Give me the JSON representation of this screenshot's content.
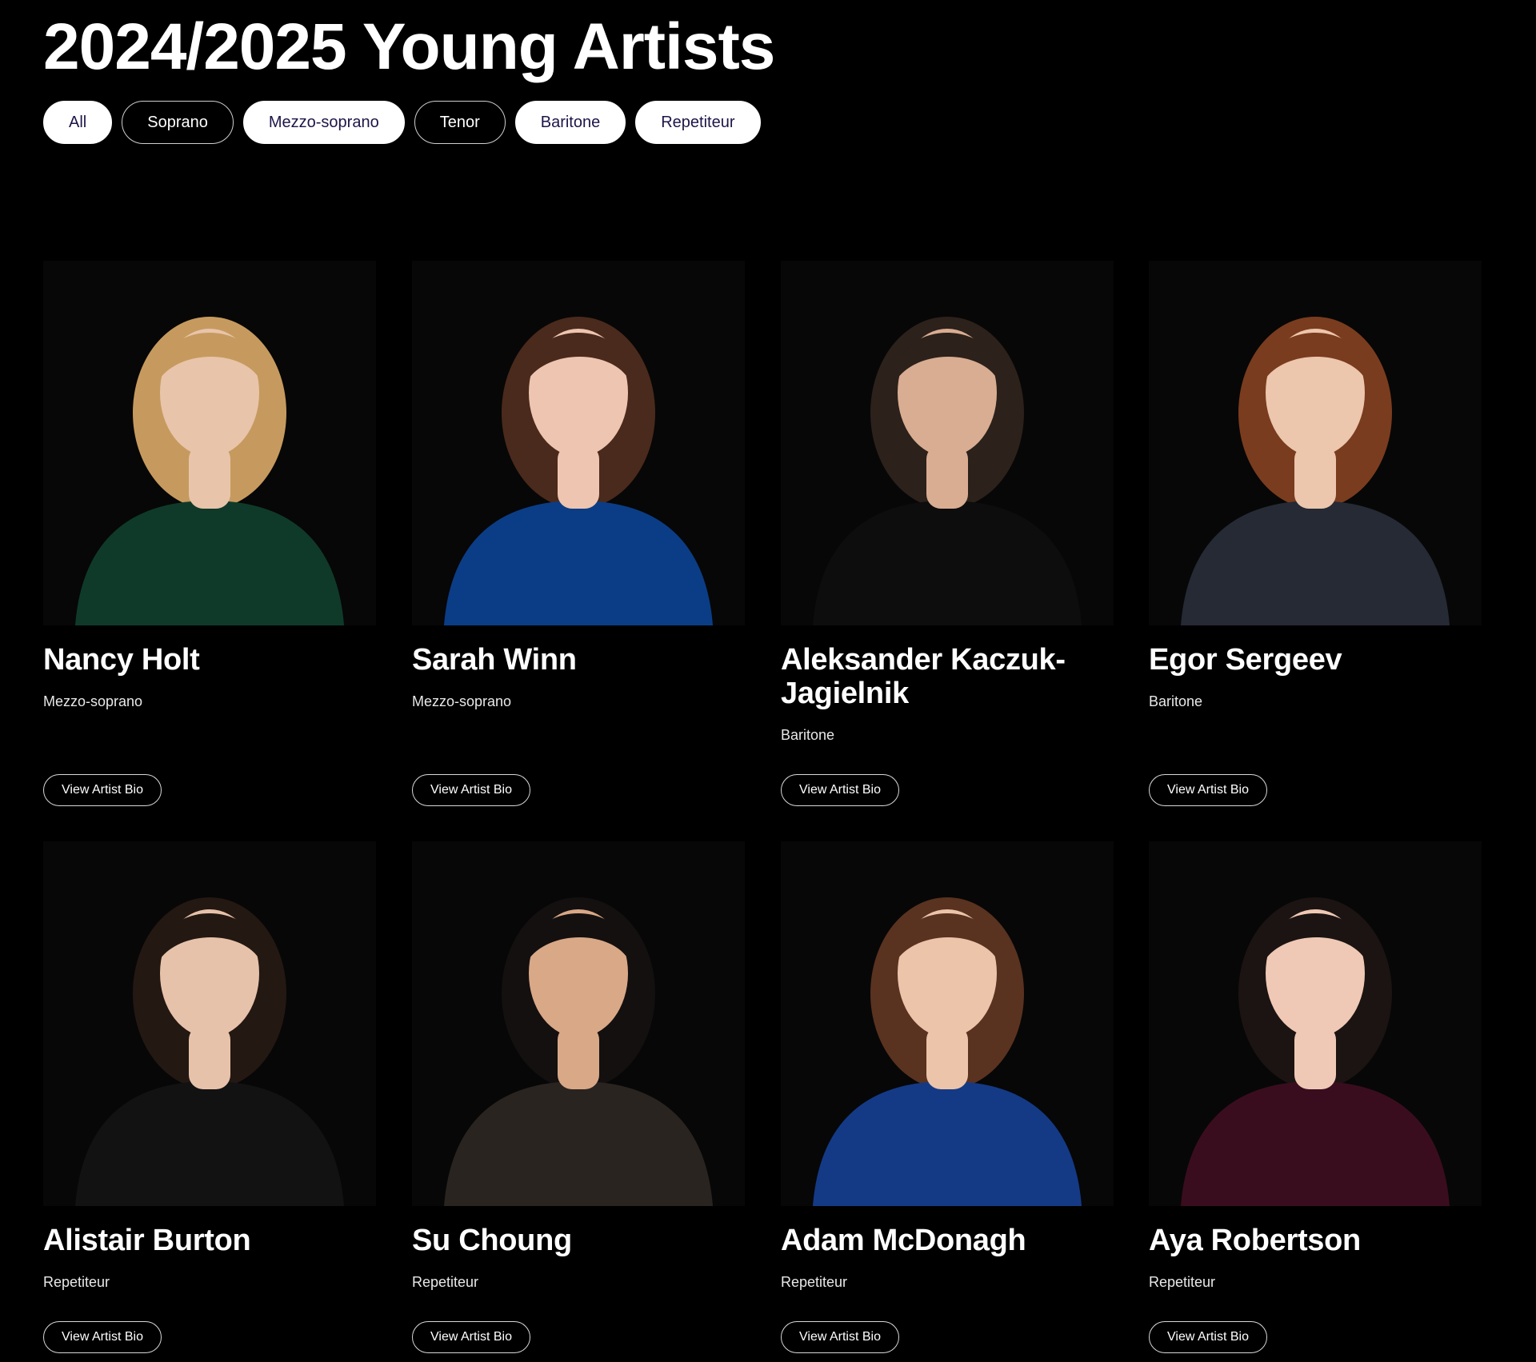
{
  "page": {
    "title": "2024/2025 Young Artists"
  },
  "filters": [
    {
      "label": "All",
      "active": true
    },
    {
      "label": "Soprano",
      "active": false
    },
    {
      "label": "Mezzo-soprano",
      "active": true
    },
    {
      "label": "Tenor",
      "active": false
    },
    {
      "label": "Baritone",
      "active": true
    },
    {
      "label": "Repetiteur",
      "active": true
    }
  ],
  "artists": [
    {
      "name": "Nancy Holt",
      "role": "Mezzo-soprano",
      "button_label": "View Artist Bio",
      "hair": "#c69a5e",
      "garment": "#0f3a2a",
      "skin": "#e8c4aa"
    },
    {
      "name": "Sarah Winn",
      "role": "Mezzo-soprano",
      "button_label": "View Artist Bio",
      "hair": "#4a2a1c",
      "garment": "#0b3d86",
      "skin": "#eec5b0"
    },
    {
      "name": "Aleksander Kaczuk-Jagielnik",
      "role": "Baritone",
      "button_label": "View Artist Bio",
      "hair": "#2c211b",
      "garment": "#0d0d0d",
      "skin": "#d9ad92"
    },
    {
      "name": "Egor Sergeev",
      "role": "Baritone",
      "button_label": "View Artist Bio",
      "hair": "#7a3c1e",
      "garment": "#252a35",
      "skin": "#ecc6ad"
    },
    {
      "name": "Alistair Burton",
      "role": "Repetiteur",
      "button_label": "View Artist Bio",
      "hair": "#241812",
      "garment": "#121212",
      "skin": "#e7c2aa"
    },
    {
      "name": "Su Choung",
      "role": "Repetiteur",
      "button_label": "View Artist Bio",
      "hair": "#141010",
      "garment": "#2a2420",
      "skin": "#d9a887"
    },
    {
      "name": "Adam McDonagh",
      "role": "Repetiteur",
      "button_label": "View Artist Bio",
      "hair": "#5a3220",
      "garment": "#143a86",
      "skin": "#ecc4aa"
    },
    {
      "name": "Aya Robertson",
      "role": "Repetiteur",
      "button_label": "View Artist Bio",
      "hair": "#1c1412",
      "garment": "#3a0d1e",
      "skin": "#efc9b5"
    }
  ]
}
